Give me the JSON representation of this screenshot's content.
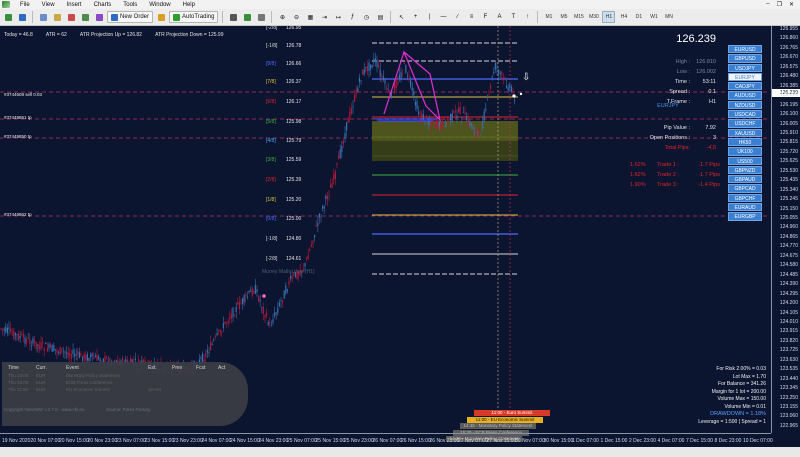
{
  "menu": [
    "File",
    "View",
    "Insert",
    "Charts",
    "Tools",
    "Window",
    "Help"
  ],
  "toolbar": {
    "new_order": "New Order",
    "autotrading": "AutoTrading",
    "timeframes": [
      "M1",
      "M5",
      "M15",
      "M30",
      "H1",
      "H4",
      "D1",
      "W1",
      "MN"
    ],
    "active_tf": "H1"
  },
  "top_info": {
    "today": "Today = 46.8",
    "atr": "ATR = 62",
    "atr_up": "ATR Projection Up = 126.82",
    "atr_down": "ATR Projection Down = 125.99"
  },
  "murrey_levels": [
    {
      "label": "[-2/8]",
      "value": "126.95",
      "color": "#d8d8d8"
    },
    {
      "label": "[-1/8]",
      "value": "126.78",
      "color": "#d8d8d8"
    },
    {
      "label": "[8/8]",
      "value": "126.66",
      "color": "#4f68ff"
    },
    {
      "label": "[7/8]",
      "value": "126.37",
      "color": "#e0c040"
    },
    {
      "label": "[6/8]",
      "value": "126.17",
      "color": "#e0242e"
    },
    {
      "label": "[5/8]",
      "value": "125.98",
      "color": "#3db23d"
    },
    {
      "label": "[4/8]",
      "value": "125.79",
      "color": "#44a4ff"
    },
    {
      "label": "[3/8]",
      "value": "125.59",
      "color": "#3db23d"
    },
    {
      "label": "[2/8]",
      "value": "125.39",
      "color": "#e0242e"
    },
    {
      "label": "[1/8]",
      "value": "125.20",
      "color": "#e0c040"
    },
    {
      "label": "[0/8]",
      "value": "125.00",
      "color": "#4f68ff"
    },
    {
      "label": "[-1/8]",
      "value": "124.80",
      "color": "#d8d8d8"
    },
    {
      "label": "[-2/8]",
      "value": "124.61",
      "color": "#d8d8d8"
    }
  ],
  "order_labels": [
    "#3744608 sell 0.03",
    "#37449861 tp",
    "#37449850 tp",
    "#37449862 tp"
  ],
  "price_axis": [
    "126.955",
    "126.860",
    "126.765",
    "126.670",
    "126.575",
    "126.480",
    "126.385",
    "126.290",
    "126.195",
    "126.100",
    "126.005",
    "125.910",
    "125.815",
    "125.720",
    "125.625",
    "125.530",
    "125.435",
    "125.340",
    "125.245",
    "125.150",
    "125.055",
    "124.960",
    "124.865",
    "124.770",
    "124.675",
    "124.580",
    "124.485",
    "124.390",
    "124.295",
    "124.200",
    "124.105",
    "124.010",
    "123.915",
    "123.820",
    "123.725",
    "123.630",
    "123.535",
    "123.440",
    "123.345",
    "123.250",
    "123.155",
    "123.060",
    "122.965"
  ],
  "current_price": "126.239",
  "time_axis": [
    "19 Nov 2020",
    "20 Nov 07:00",
    "20 Nov 15:00",
    "20 Nov 23:00",
    "23 Nov 07:00",
    "23 Nov 15:00",
    "23 Nov 23:00",
    "24 Nov 07:00",
    "24 Nov 15:00",
    "24 Nov 23:00",
    "25 Nov 07:00",
    "25 Nov 15:00",
    "25 Nov 23:00",
    "26 Nov 07:00",
    "26 Nov 15:00",
    "26 Nov 23:00",
    "27 Nov 07:00",
    "27 Nov 15:00",
    "30 Nov 07:00",
    "30 Nov 15:00",
    "1 Dec 07:00",
    "1 Dec 15:00",
    "2 Dec 23:00",
    "4 Dec 07:00",
    "7 Dec 15:00",
    "8 Dec 23:00",
    "10 Dec 07:00"
  ],
  "panel": {
    "big_price": "126.239",
    "rows": [
      {
        "k": "High :",
        "v": "126.810",
        "dim": true
      },
      {
        "k": "Low :",
        "v": "126.002",
        "dim": true
      },
      {
        "k": "Time :",
        "v": "53:11",
        "dim": false
      },
      {
        "k": "Spread :",
        "v": "0.1",
        "dim": false
      },
      {
        "k": "T.Frame :",
        "v": "H1",
        "dim": false
      }
    ],
    "symbol_title": "EURJPY",
    "pip_value_k": "Pip Value :",
    "pip_value_v": "7.92",
    "open_positions_k": "Open Positions :",
    "open_positions_v": "3",
    "total_pips_k": "Total Pips:",
    "total_pips_v": "-4.8",
    "trades": [
      {
        "pct": "1.62%",
        "name": "Trade 1 :",
        "pips": "-1.7 Pips"
      },
      {
        "pct": "1.62%",
        "name": "Trade 2 :",
        "pips": "-1.7 Pips"
      },
      {
        "pct": "1.90%",
        "name": "Trade 3 :",
        "pips": "-1.4 Pips"
      }
    ]
  },
  "symbols": [
    "EURUSD",
    "GBPUSD",
    "USDJPY",
    "EURJPY",
    "CADJPY",
    "AUDUSD",
    "NZDUSD",
    "USDCAD",
    "USDCHF",
    "XAUUSD",
    "HK50",
    "UK100",
    "US500",
    "GBPNZD",
    "GBPAUD",
    "GBPCAD",
    "GBPCHF",
    "EURAUD",
    "EURGBP"
  ],
  "active_symbol": "EURJPY",
  "risk": [
    "For Risk 2.00% = 0.03",
    "Lot Max = 1.70",
    "For Balance = 341.26",
    "Margin for 1 lot = 200.00",
    "Volume Max = 150.00",
    "Volume Min = 0.01"
  ],
  "drawdown": "DRAWDOWN = 1.18%",
  "leverage": "Leverage = 1:500 | Spread = 1",
  "news": {
    "headers": [
      "Time",
      "Curr.",
      "Event",
      "Est.",
      "Prev",
      "Fcst",
      "Act"
    ],
    "rows": [
      [
        "Thu 14:00",
        "EUR",
        "Monetary Policy Statement",
        "",
        "",
        "",
        ""
      ],
      [
        "Thu 15:00",
        "EUR",
        "ECB Press Conference",
        "",
        "",
        "",
        ""
      ],
      [
        "Thu 11:00",
        "EUR",
        "EU Economic Summit",
        "19 Hrs",
        "",
        "",
        ""
      ]
    ]
  },
  "bottom_news": [
    {
      "text": "11:00 - Euro Summit",
      "bg": "#d83a2a",
      "fg": "#ffffff"
    },
    {
      "text": "11:00 - EU Economic Summit",
      "bg": "#e8b020",
      "fg": "#111111"
    },
    {
      "text": "14:45 - Monetary Policy Statement",
      "bg": "#5a5a5a",
      "fg": "#bbbbbb"
    },
    {
      "text": "15:30 - ECB Press Conference",
      "bg": "#5a5a5a",
      "fg": "#bbbbbb"
    },
    {
      "text": "14:30 - Monetary Policy Statement",
      "bg": "#5a5a5a",
      "fg": "#bbbbbb"
    }
  ],
  "copyright": "Copyright NewsWiz v.2.7.0 - www.cfx.eu",
  "source": "Source: Forex Factory",
  "murrey_small": "Murrey Math Lines (H1)"
}
